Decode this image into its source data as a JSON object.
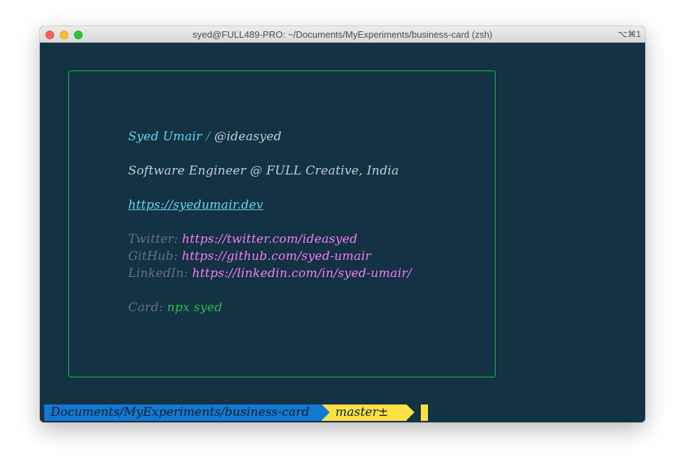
{
  "window": {
    "title": "syed@FULL489-PRO: ~/Documents/MyExperiments/business-card (zsh)",
    "shortcut": "⌥⌘1"
  },
  "card": {
    "name": "Syed Umair",
    "separator": "/",
    "handle": "@ideasyed",
    "role": "Software Engineer @ FULL Creative, India",
    "website": "https://syedumair.dev",
    "twitter_label": "Twitter:",
    "twitter_url": "https://twitter.com/ideasyed",
    "github_label": "GitHub:",
    "github_url": "https://github.com/syed-umair",
    "linkedin_label": "LinkedIn:",
    "linkedin_url": "https://linkedin.com/in/syed-umair/",
    "card_label": "Card:",
    "card_command": "npx syed"
  },
  "prompt": {
    "path": "Documents/MyExperiments/business-card",
    "git_icon": "",
    "branch": "master±"
  },
  "colors": {
    "terminal_bg": "#133244",
    "border": "#22bd4a",
    "name": "#63d9ee",
    "link": "#f97bf7",
    "label": "#6a7278",
    "path_segment": "#1379d2",
    "git_segment": "#fde143"
  }
}
